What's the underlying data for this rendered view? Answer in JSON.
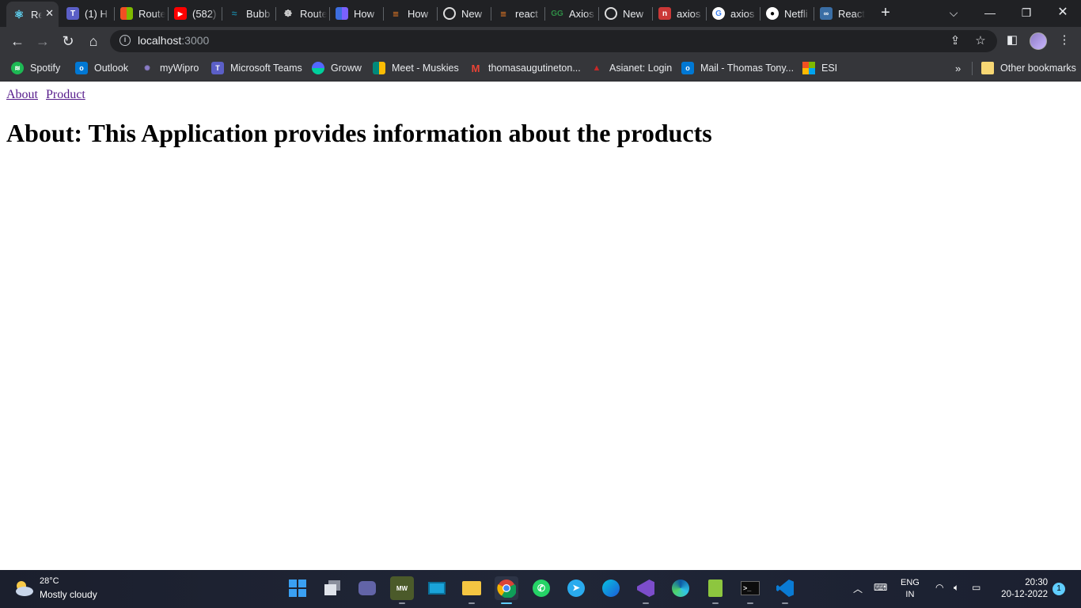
{
  "browser": {
    "tabs": [
      {
        "title": "Re",
        "icon": "react-icon",
        "color": "#61dafb",
        "active": true
      },
      {
        "title": "(1) H",
        "icon": "teams-icon",
        "color": "#5b5fc7"
      },
      {
        "title": "Route",
        "icon": "microsoft-icon",
        "color": "#f25022"
      },
      {
        "title": "(582)",
        "icon": "youtube-icon",
        "color": "#ff0000"
      },
      {
        "title": "Bubb",
        "icon": "bubble-icon",
        "color": "#1b7f9b"
      },
      {
        "title": "Route",
        "icon": "router-icon",
        "color": "#cccccc"
      },
      {
        "title": "How",
        "icon": "grid-icon",
        "color": "#3d6ee0"
      },
      {
        "title": "How",
        "icon": "stackoverflow-icon",
        "color": "#f48024"
      },
      {
        "title": "New",
        "icon": "chrome-icon",
        "color": "#dddddd"
      },
      {
        "title": "react",
        "icon": "stackoverflow-icon",
        "color": "#f48024"
      },
      {
        "title": "Axios",
        "icon": "geeks-icon",
        "color": "#2f8d46"
      },
      {
        "title": "New",
        "icon": "chrome-icon",
        "color": "#dddddd"
      },
      {
        "title": "axios",
        "icon": "npm-icon",
        "color": "#cb3837"
      },
      {
        "title": "axios",
        "icon": "google-icon",
        "color": "#4285f4"
      },
      {
        "title": "Netfli",
        "icon": "github-icon",
        "color": "#ffffff"
      },
      {
        "title": "React",
        "icon": "codesandbox-icon",
        "color": "#3a6ea5"
      }
    ],
    "new_tab": "+",
    "window_controls": {
      "tab_search": "⌵",
      "minimize": "—",
      "restore": "❐",
      "close": "✕"
    },
    "url": {
      "host": "localhost",
      "port": ":3000"
    },
    "bookmarks": [
      {
        "label": "Spotify",
        "icon": "spotify-icon",
        "color": "#1db954"
      },
      {
        "label": "Outlook",
        "icon": "outlook-icon",
        "color": "#0078d4"
      },
      {
        "label": "myWipro",
        "icon": "wipro-icon",
        "color": "#6b5ca5"
      },
      {
        "label": "Microsoft Teams",
        "icon": "teams-icon",
        "color": "#5b5fc7"
      },
      {
        "label": "Groww",
        "icon": "groww-icon",
        "color": "#5367ff"
      },
      {
        "label": "Meet - Muskies",
        "icon": "meet-icon",
        "color": "#00897b"
      },
      {
        "label": "thomasaugutineton...",
        "icon": "gmail-icon",
        "color": "#ea4335"
      },
      {
        "label": "Asianet: Login",
        "icon": "asianet-icon",
        "color": "#c62828"
      },
      {
        "label": "Mail - Thomas Tony...",
        "icon": "outlook-icon",
        "color": "#0078d4"
      },
      {
        "label": "ESI",
        "icon": "microsoft-icon",
        "color": "#f25022"
      }
    ],
    "bookmarks_more": "»",
    "other_bookmarks": "Other bookmarks"
  },
  "page": {
    "nav_links": [
      "About",
      "Product"
    ],
    "heading": "About: This Application provides information about the products"
  },
  "taskbar": {
    "temperature": "28°C",
    "condition": "Mostly cloudy",
    "language": "ENG",
    "region": "IN",
    "time": "20:30",
    "date": "20-12-2022",
    "notifications": "1"
  }
}
